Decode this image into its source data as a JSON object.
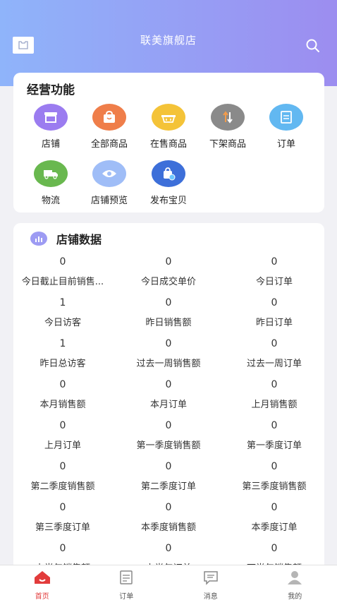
{
  "header": {
    "title": "联美旗舰店"
  },
  "functions": {
    "title": "经营功能",
    "items": [
      {
        "label": "店铺",
        "icon": "store-icon",
        "color": "#9b7cf0"
      },
      {
        "label": "全部商品",
        "icon": "bag-icon",
        "color": "#ef7e4a"
      },
      {
        "label": "在售商品",
        "icon": "basket-icon",
        "color": "#f4c338"
      },
      {
        "label": "下架商品",
        "icon": "sort-arrows-icon",
        "color": "#8a8a8a"
      },
      {
        "label": "订单",
        "icon": "order-list-icon",
        "color": "#62b8f1"
      },
      {
        "label": "物流",
        "icon": "truck-icon",
        "color": "#69b84f"
      },
      {
        "label": "店铺预览",
        "icon": "eye-icon",
        "color": "#9fbdf7"
      },
      {
        "label": "发布宝贝",
        "icon": "publish-bag-icon",
        "color": "#3d6fd9"
      }
    ]
  },
  "store_data": {
    "title": "店铺数据",
    "cells": [
      {
        "value": "0",
        "label": "今日截止目前销售..."
      },
      {
        "value": "0",
        "label": "今日成交单价"
      },
      {
        "value": "0",
        "label": "今日订单"
      },
      {
        "value": "1",
        "label": "今日访客"
      },
      {
        "value": "0",
        "label": "昨日销售额"
      },
      {
        "value": "0",
        "label": "昨日订单"
      },
      {
        "value": "1",
        "label": "昨日总访客"
      },
      {
        "value": "0",
        "label": "过去一周销售额"
      },
      {
        "value": "0",
        "label": "过去一周订单"
      },
      {
        "value": "0",
        "label": "本月销售额"
      },
      {
        "value": "0",
        "label": "本月订单"
      },
      {
        "value": "0",
        "label": "上月销售额"
      },
      {
        "value": "0",
        "label": "上月订单"
      },
      {
        "value": "0",
        "label": "第一季度销售额"
      },
      {
        "value": "0",
        "label": "第一季度订单"
      },
      {
        "value": "0",
        "label": "第二季度销售额"
      },
      {
        "value": "0",
        "label": "第二季度订单"
      },
      {
        "value": "0",
        "label": "第三季度销售额"
      },
      {
        "value": "0",
        "label": "第三季度订单"
      },
      {
        "value": "0",
        "label": "本季度销售额"
      },
      {
        "value": "0",
        "label": "本季度订单"
      },
      {
        "value": "0",
        "label": "上半年销售额"
      },
      {
        "value": "0",
        "label": "上半年订单"
      },
      {
        "value": "0",
        "label": "下半年销售额"
      }
    ]
  },
  "tabbar": {
    "items": [
      {
        "label": "首页",
        "icon": "home-icon",
        "active": true
      },
      {
        "label": "订单",
        "icon": "order-icon",
        "active": false
      },
      {
        "label": "消息",
        "icon": "message-icon",
        "active": false
      },
      {
        "label": "我的",
        "icon": "profile-icon",
        "active": false
      }
    ],
    "active_color": "#e23b3b"
  }
}
